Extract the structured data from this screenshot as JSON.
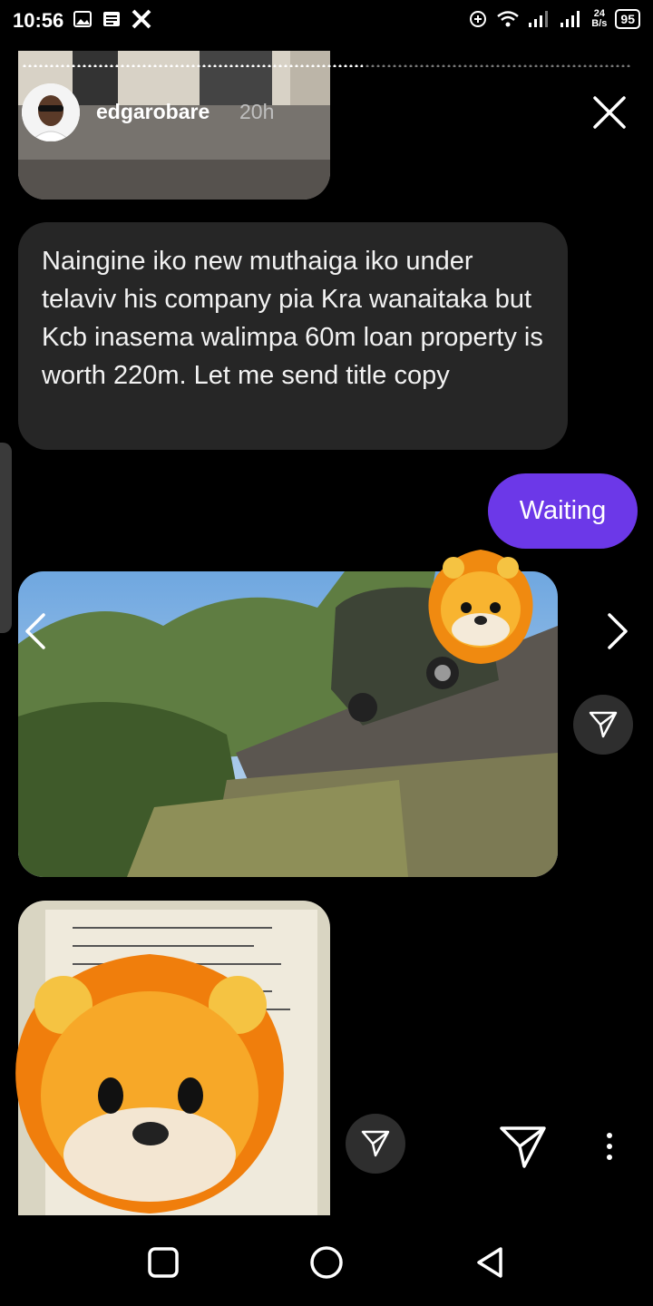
{
  "status_bar": {
    "time": "10:56",
    "network_speed_value": "24",
    "network_speed_unit": "B/s",
    "battery": "95",
    "left_icons": [
      "gallery-icon",
      "news-icon",
      "x-app-icon"
    ],
    "right_icons": [
      "data-saver-icon",
      "wifi-icon",
      "signal-icon",
      "signal-icon"
    ]
  },
  "story": {
    "username": "edgarobare",
    "time_ago": "20h",
    "progress": 0.56
  },
  "messages": {
    "incoming_text": "Naingine iko new muthaiga iko under telaviv his company pia Kra wanaitaka but Kcb inasema walimpa 60m loan property is worth 220m. Let me send title copy",
    "outgoing_text": "Waiting"
  },
  "colors": {
    "outgoing_bubble": "#6c38e8",
    "incoming_bubble": "#262626",
    "background": "#000000"
  },
  "nav_bar": {
    "buttons": [
      "recents-square-icon",
      "home-circle-icon",
      "back-triangle-icon"
    ]
  }
}
